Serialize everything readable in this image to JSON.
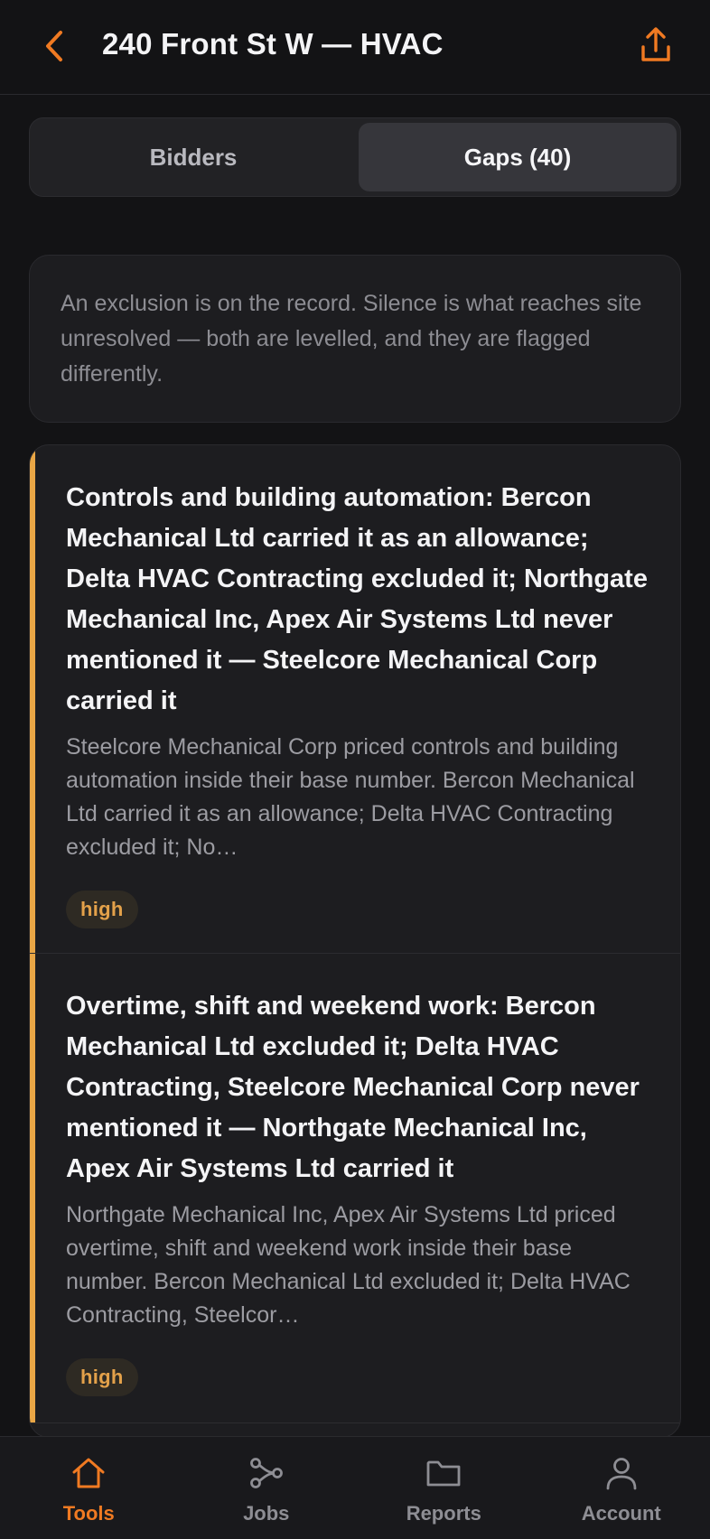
{
  "header": {
    "title": "240 Front St W — HVAC",
    "back_icon": "chevron-left-icon",
    "share_icon": "share-icon",
    "accent_color": "#f07a22"
  },
  "segmented": {
    "tabs": [
      {
        "label": "Bidders",
        "selected": false
      },
      {
        "label": "Gaps (40)",
        "selected": true
      }
    ]
  },
  "note": {
    "text": "An exclusion is on the record. Silence is what reaches site unresolved — both are levelled, and they are flagged differently."
  },
  "gaps": [
    {
      "title": "Controls and building automation: Bercon Mechanical Ltd carried it as an allowance; Delta HVAC Contracting excluded it; Northgate Mechanical Inc, Apex Air Systems Ltd never mentioned it — Steelcore Mechanical Corp carried it",
      "body": "Steelcore Mechanical Corp priced controls and building automation inside their base number. Bercon Mechanical Ltd carried it as an allowance; Delta HVAC Contracting excluded it; No…",
      "severity": "high",
      "severity_color": "#e9a645"
    },
    {
      "title": "Overtime, shift and weekend work: Bercon Mechanical Ltd excluded it; Delta HVAC Contracting, Steelcore Mechanical Corp never mentioned it — Northgate Mechanical Inc, Apex Air Systems Ltd carried it",
      "body": "Northgate Mechanical Inc, Apex Air Systems Ltd priced overtime, shift and weekend work inside their base number. Bercon Mechanical Ltd excluded it; Delta HVAC Contracting, Steelcor…",
      "severity": "high",
      "severity_color": "#e9a645"
    }
  ],
  "tabbar": {
    "items": [
      {
        "label": "Tools",
        "icon": "home-icon",
        "active": true
      },
      {
        "label": "Jobs",
        "icon": "share-nodes-icon",
        "active": false
      },
      {
        "label": "Reports",
        "icon": "folder-icon",
        "active": false
      },
      {
        "label": "Account",
        "icon": "person-icon",
        "active": false
      }
    ]
  }
}
